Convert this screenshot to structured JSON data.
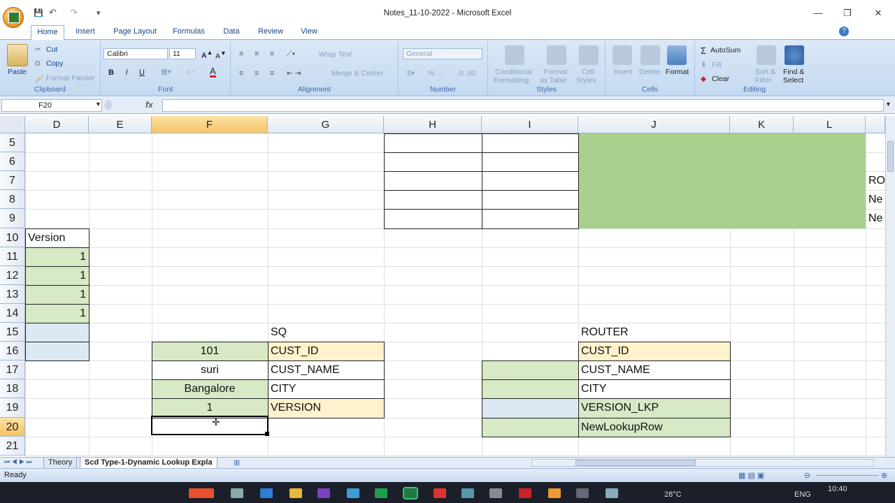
{
  "window": {
    "title": "Notes_11-10-2022 - Microsoft Excel",
    "minimize": "—",
    "restore": "❐",
    "close": "✕"
  },
  "qat": {
    "save": "💾",
    "undo": "↶",
    "redo": "↷",
    "more": "▾"
  },
  "tabs": [
    "Home",
    "Insert",
    "Page Layout",
    "Formulas",
    "Data",
    "Review",
    "View"
  ],
  "ribbon": {
    "clipboard": {
      "paste": "Paste",
      "cut": "Cut",
      "copy": "Copy",
      "format_painter": "Format Painter",
      "label": "Clipboard"
    },
    "font": {
      "name": "Calibri",
      "size": "11",
      "bold": "B",
      "italic": "I",
      "underline": "U",
      "label": "Font"
    },
    "alignment": {
      "wrap": "Wrap Text",
      "merge": "Merge & Center",
      "label": "Alignment"
    },
    "number": {
      "format": "General",
      "percent": "%",
      "label": "Number"
    },
    "styles": {
      "cond": "Conditional Formatting",
      "cond1": "Conditional",
      "cond2": "Formatting",
      "table1": "Format",
      "table2": "as Table",
      "cell1": "Cell",
      "cell2": "Styles",
      "label": "Styles"
    },
    "cells": {
      "insert": "Insert",
      "delete": "Delete",
      "format": "Format",
      "label": "Cells"
    },
    "editing": {
      "autosum": "AutoSum",
      "fill": "Fill",
      "clear": "Clear",
      "sort1": "Sort &",
      "sort2": "Filter",
      "find1": "Find &",
      "find2": "Select",
      "label": "Editing"
    }
  },
  "formula_bar": {
    "name_box": "F20",
    "fx": "fx",
    "formula": ""
  },
  "columns": [
    "D",
    "E",
    "F",
    "G",
    "H",
    "I",
    "J",
    "K",
    "L"
  ],
  "rows": [
    "5",
    "6",
    "7",
    "8",
    "9",
    "10",
    "11",
    "12",
    "13",
    "14",
    "15",
    "16",
    "17",
    "18",
    "19",
    "20",
    "21"
  ],
  "cells": {
    "d10": "Version",
    "d11": "1",
    "d12": "1",
    "d13": "1",
    "d14": "1",
    "g15": "SQ",
    "f16": "101",
    "g16": "CUST_ID",
    "f17": "suri",
    "g17": "CUST_NAME",
    "f18": "Bangalore",
    "g18": "CITY",
    "f19": "1",
    "g19": "VERSION",
    "j15": "ROUTER",
    "j16": "CUST_ID",
    "j17": "CUST_NAME",
    "j18": "CITY",
    "j19": "VERSION_LKP",
    "j20": "NewLookupRow",
    "m7": "RO",
    "m8": "Ne",
    "m9": "Ne"
  },
  "colors": {
    "green": "#a9d18e",
    "light_green": "#d8e9c6",
    "yellow": "#fff2cc",
    "light_blue": "#dce9f5",
    "selected_header": "#f6c367"
  },
  "sheets": [
    "Theory",
    "Scd Type-1-Dynamic Lookup Expla"
  ],
  "status": {
    "ready": "Ready"
  },
  "taskbar": {
    "weather": "28°C",
    "lang": "ENG",
    "time": "10:40"
  }
}
